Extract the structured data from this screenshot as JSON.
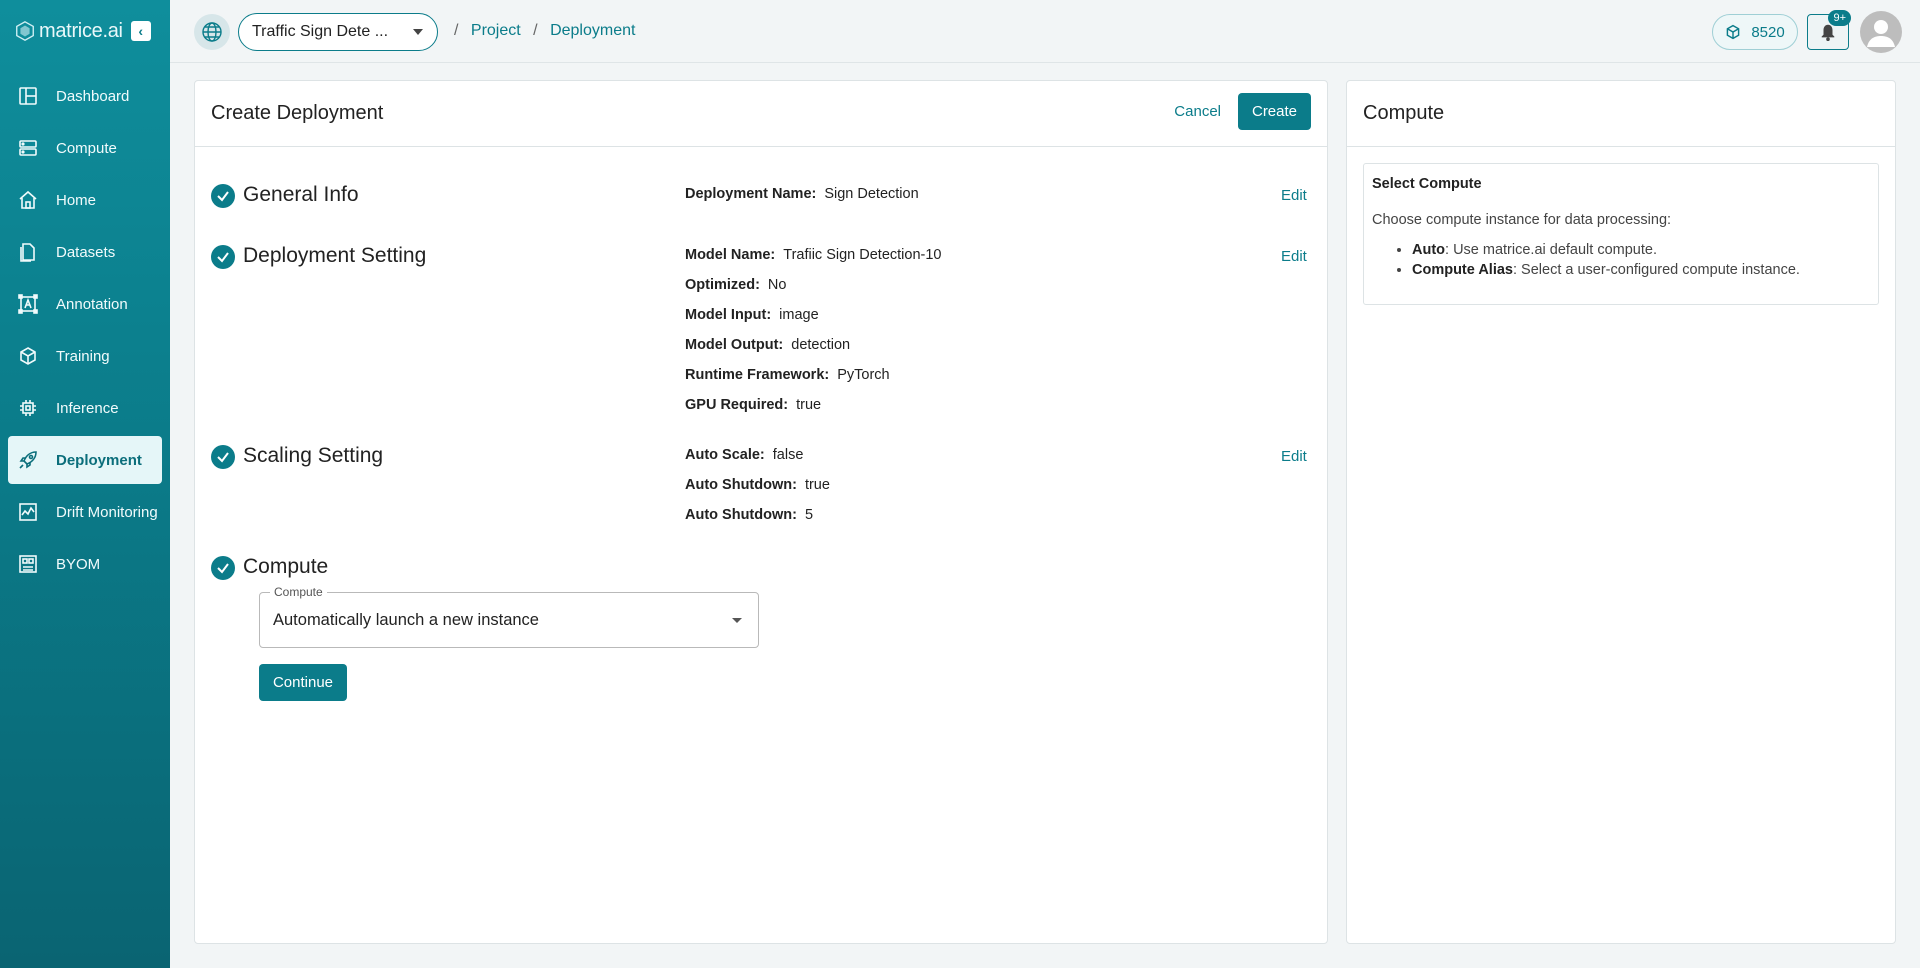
{
  "brand": {
    "name": "matrice.ai"
  },
  "sidebar": {
    "items": [
      {
        "label": "Dashboard",
        "icon": "dashboard-icon"
      },
      {
        "label": "Compute",
        "icon": "server-icon"
      },
      {
        "label": "Home",
        "icon": "home-icon"
      },
      {
        "label": "Datasets",
        "icon": "document-icon"
      },
      {
        "label": "Annotation",
        "icon": "annotation-icon"
      },
      {
        "label": "Training",
        "icon": "cube-icon"
      },
      {
        "label": "Inference",
        "icon": "chip-icon"
      },
      {
        "label": "Deployment",
        "icon": "rocket-icon",
        "active": true
      },
      {
        "label": "Drift Monitoring",
        "icon": "chart-icon"
      },
      {
        "label": "BYOM",
        "icon": "model-icon"
      }
    ]
  },
  "topbar": {
    "project": "Traffic Sign Dete ...",
    "breadcrumb": [
      "Project",
      "Deployment"
    ],
    "credits": "8520",
    "notifications_badge": "9+"
  },
  "main": {
    "title": "Create Deployment",
    "cancel_label": "Cancel",
    "create_label": "Create",
    "edit_label": "Edit",
    "steps": {
      "general": {
        "title": "General Info",
        "fields": [
          {
            "label": "Deployment Name:",
            "value": "Sign Detection"
          }
        ]
      },
      "deployment": {
        "title": "Deployment Setting",
        "fields": [
          {
            "label": "Model Name:",
            "value": "Trafiic Sign Detection-10"
          },
          {
            "label": "Optimized:",
            "value": "No"
          },
          {
            "label": "Model Input:",
            "value": "image"
          },
          {
            "label": "Model Output:",
            "value": "detection"
          },
          {
            "label": "Runtime Framework:",
            "value": "PyTorch"
          },
          {
            "label": "GPU Required:",
            "value": "true"
          }
        ]
      },
      "scaling": {
        "title": "Scaling Setting",
        "fields": [
          {
            "label": "Auto Scale:",
            "value": "false"
          },
          {
            "label": "Auto Shutdown:",
            "value": "true"
          },
          {
            "label": "Auto Shutdown:",
            "value": "5"
          }
        ]
      },
      "compute": {
        "title": "Compute",
        "select_legend": "Compute",
        "select_value": "Automatically launch a new instance",
        "continue_label": "Continue"
      }
    }
  },
  "side": {
    "title": "Compute",
    "help_title": "Select Compute",
    "help_desc": "Choose compute instance for data processing:",
    "help_items": [
      {
        "term": "Auto",
        "desc": ": Use matrice.ai default compute."
      },
      {
        "term": "Compute Alias",
        "desc": ": Select a user-configured compute instance."
      }
    ]
  },
  "colors": {
    "accent": "#0b7c8a",
    "sidebar_active_bg": "#e5f6f8"
  }
}
